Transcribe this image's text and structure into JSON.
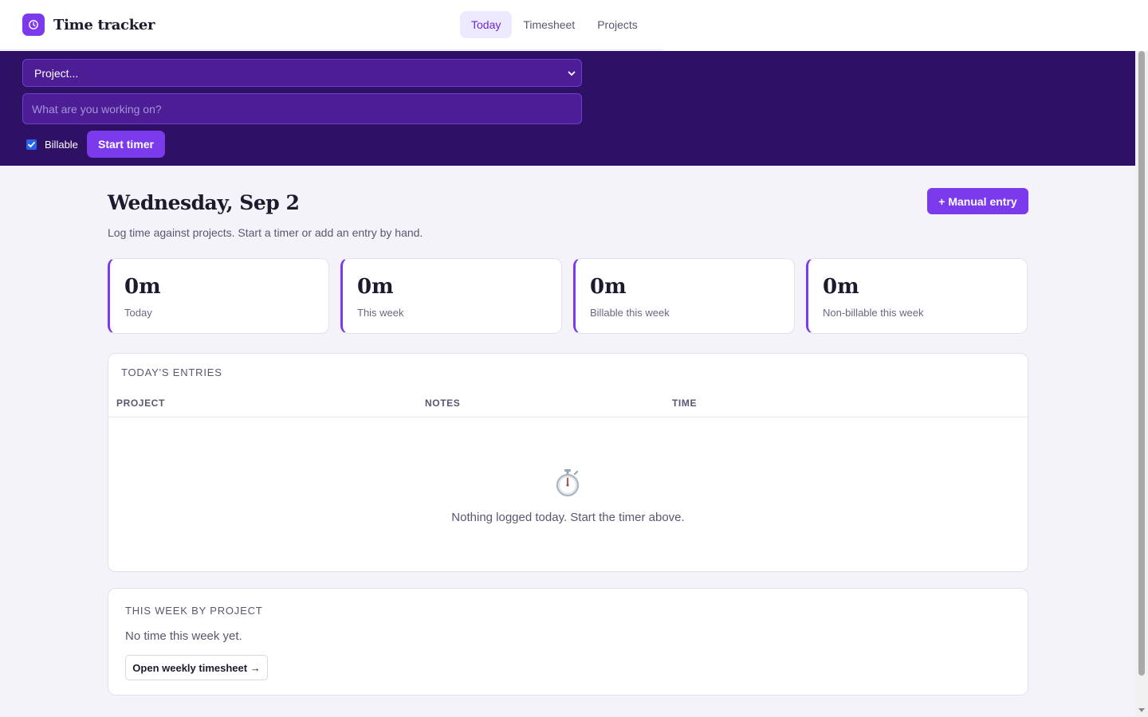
{
  "app": {
    "title": "Time tracker",
    "icon": "clock-icon",
    "accent": "#7c3aed"
  },
  "nav": {
    "tabs": [
      {
        "label": "Today",
        "active": true
      },
      {
        "label": "Timesheet",
        "active": false
      },
      {
        "label": "Projects",
        "active": false
      }
    ]
  },
  "timer": {
    "project_select_value": "Project...",
    "task_placeholder": "What are you working on?",
    "billable_label": "Billable",
    "billable_checked": true,
    "start_label": "Start timer"
  },
  "page": {
    "title": "Wednesday, Sep 2",
    "subtitle": "Log time against projects. Start a timer or add an entry by hand.",
    "manual_entry_label": "+ Manual entry"
  },
  "stats": [
    {
      "value": "0m",
      "label": "Today"
    },
    {
      "value": "0m",
      "label": "This week"
    },
    {
      "value": "0m",
      "label": "Billable this week"
    },
    {
      "value": "0m",
      "label": "Non-billable this week"
    }
  ],
  "entries": {
    "title": "TODAY'S ENTRIES",
    "columns": [
      "PROJECT",
      "NOTES",
      "TIME"
    ],
    "rows": [],
    "empty_icon": "stopwatch-icon",
    "empty_text": "Nothing logged today. Start the timer above."
  },
  "week": {
    "title": "THIS WEEK BY PROJECT",
    "empty_text": "No time this week yet.",
    "open_button_label": "Open weekly timesheet →"
  }
}
